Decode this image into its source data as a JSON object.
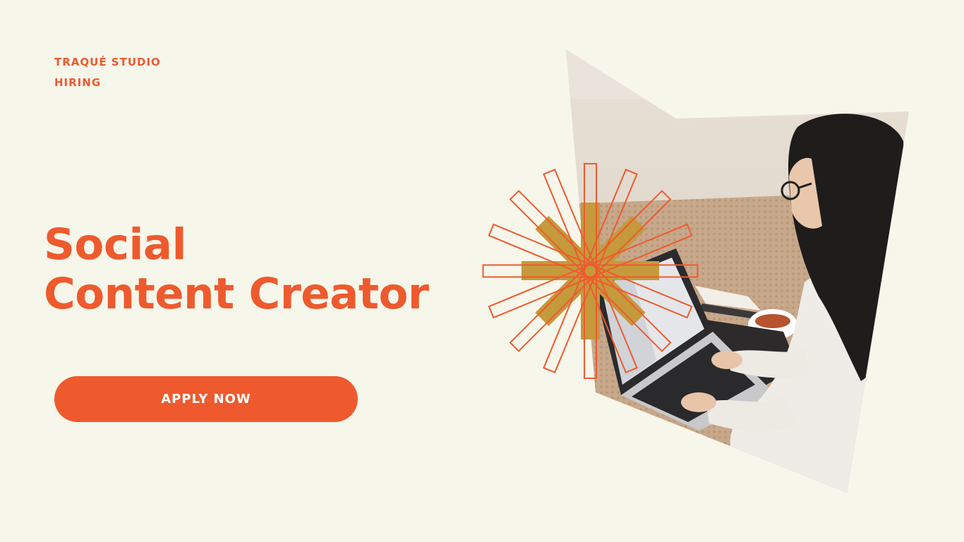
{
  "brand": {
    "studio": "TRAQUÉ STUDIO",
    "status": "HIRING"
  },
  "headline": {
    "line1": "Social",
    "line2": "Content Creator"
  },
  "cta": {
    "label": "APPLY NOW"
  },
  "colors": {
    "background": "#f7f6ea",
    "accent": "#ee5a2e",
    "burst_fill": "#c49a3c",
    "button_text": "#ffffff"
  },
  "photo": {
    "icon": "woman-typing-on-laptop-photo"
  },
  "decoration": {
    "icon": "starburst-icon"
  }
}
